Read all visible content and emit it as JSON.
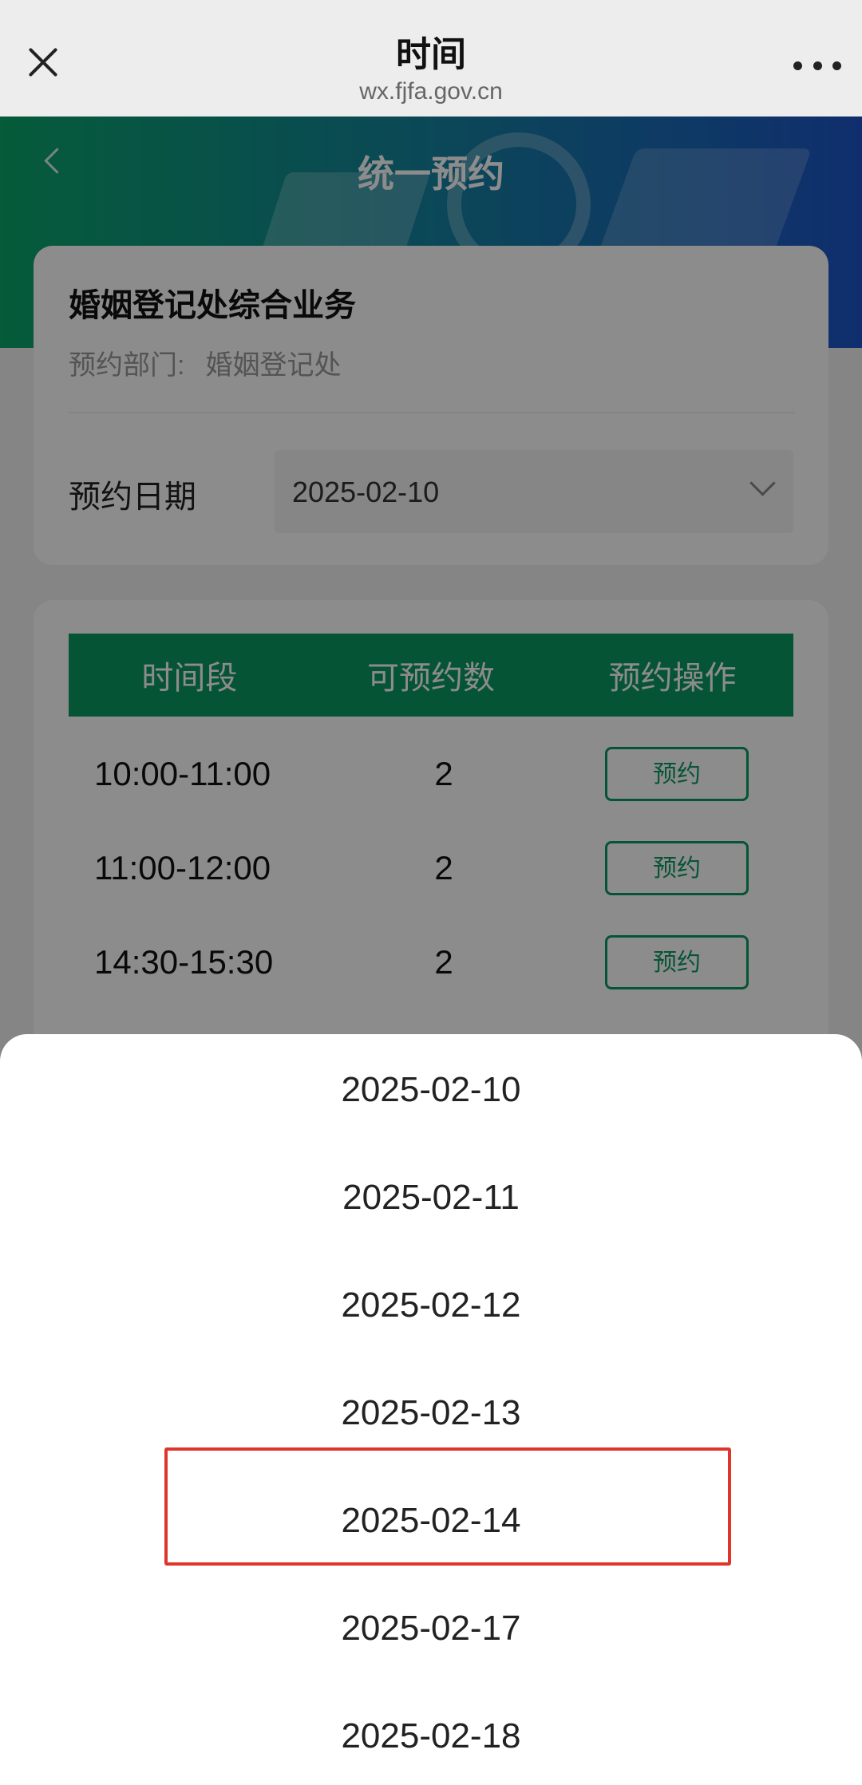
{
  "browser": {
    "title": "时间",
    "url": "wx.fjfa.gov.cn"
  },
  "banner": {
    "title": "统一预约"
  },
  "service": {
    "name": "婚姻登记处综合业务",
    "dept_label": "预约部门:",
    "dept_value": "婚姻登记处"
  },
  "date_field": {
    "label": "预约日期",
    "value": "2025-02-10"
  },
  "table": {
    "headers": [
      "时间段",
      "可预约数",
      "预约操作"
    ],
    "rows": [
      {
        "time": "10:00-11:00",
        "count": "2",
        "action": "预约"
      },
      {
        "time": "11:00-12:00",
        "count": "2",
        "action": "预约"
      },
      {
        "time": "14:30-15:30",
        "count": "2",
        "action": "预约"
      }
    ]
  },
  "picker": {
    "options": [
      "2025-02-10",
      "2025-02-11",
      "2025-02-12",
      "2025-02-13",
      "2025-02-14",
      "2025-02-17",
      "2025-02-18"
    ],
    "highlighted": "2025-02-14"
  },
  "colors": {
    "primary_green": "#0b9a63",
    "highlight_red": "#e0352b"
  }
}
